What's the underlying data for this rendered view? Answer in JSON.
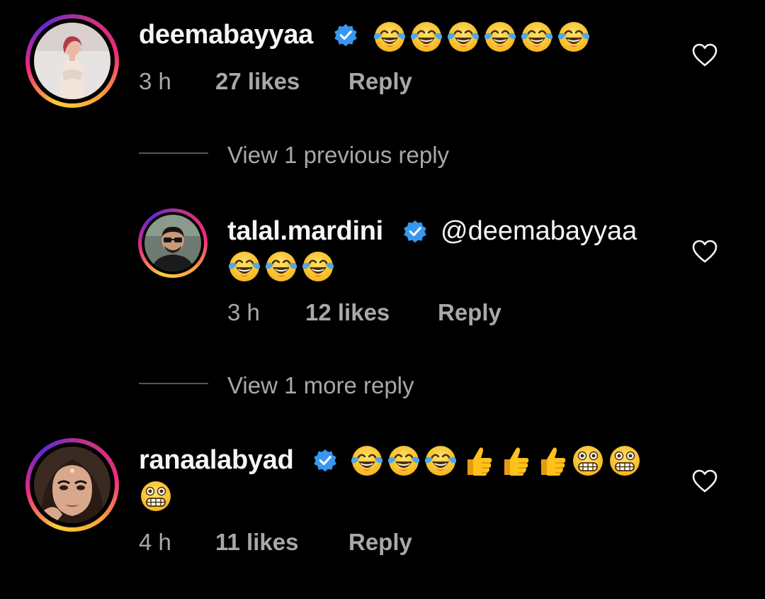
{
  "comments": [
    {
      "username": "deemabayyaa",
      "verified": true,
      "emojis": [
        "face-with-tears-of-joy",
        "face-with-tears-of-joy",
        "face-with-tears-of-joy",
        "face-with-tears-of-joy",
        "face-with-tears-of-joy",
        "face-with-tears-of-joy"
      ],
      "time": "3 h",
      "likes": "27 likes",
      "reply_label": "Reply"
    },
    {
      "username": "talal.mardini",
      "verified": true,
      "mention": "@deemabayyaa",
      "emojis": [
        "face-with-tears-of-joy",
        "face-with-tears-of-joy",
        "face-with-tears-of-joy"
      ],
      "time": "3 h",
      "likes": "12 likes",
      "reply_label": "Reply"
    },
    {
      "username": "ranaalabyad",
      "verified": true,
      "emojis": [
        "face-with-tears-of-joy",
        "face-with-tears-of-joy",
        "face-with-tears-of-joy",
        "thumbs-up",
        "thumbs-up",
        "thumbs-up",
        "grimacing-face",
        "grimacing-face",
        "grimacing-face"
      ],
      "time": "4 h",
      "likes": "11 likes",
      "reply_label": "Reply"
    }
  ],
  "threads": {
    "view_previous": "View 1 previous reply",
    "view_more": "View 1 more reply"
  },
  "colors": {
    "background": "#000000",
    "text": "#f5f5f5",
    "muted": "#a8a8a8",
    "verified": "#3897f0"
  }
}
